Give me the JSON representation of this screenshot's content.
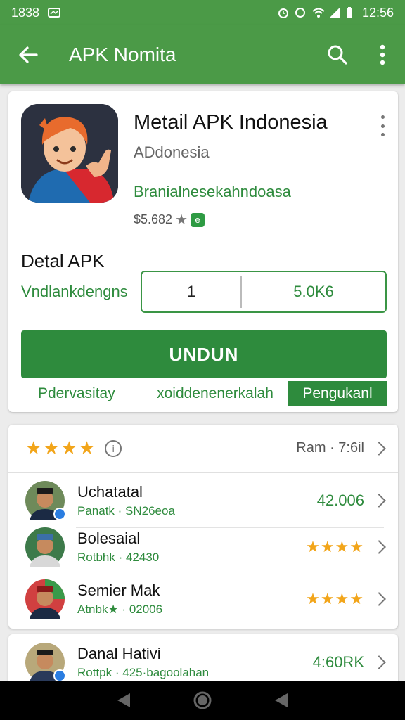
{
  "status": {
    "time_left": "1838",
    "time_right": "12:56"
  },
  "appbar": {
    "title": "APK Nomita",
    "back_icon": "arrow-left-icon",
    "search_icon": "search-icon",
    "more_icon": "more-vert-icon"
  },
  "app": {
    "name": "Metail APK Indonesia",
    "subtitle": "ADdonesia",
    "developer": "Branialnesekahndoasa",
    "price": "$5.682",
    "star": "★",
    "badge": "e"
  },
  "detail": {
    "title": "Detal APK",
    "label": "Vndlankdengns",
    "quantity": "1",
    "size": "5.0K6"
  },
  "download_button": "UNDUN",
  "tabs": [
    "Pdervasitay",
    "xoiddenenerkalah",
    "Pengukanl"
  ],
  "rating": {
    "stars": "★★★★",
    "info_icon": "i",
    "summary": "Ram · 7:6il"
  },
  "reviews": [
    {
      "name": "Uchatatal",
      "meta": "Panatk · SN26eoa",
      "right": "42.006",
      "stars": ""
    },
    {
      "name": "Bolesaial",
      "meta": "Rotbhk · 42430",
      "right": "",
      "stars": "★★★★"
    },
    {
      "name": "Semier Mak",
      "meta": "Atnbk★ · 02006",
      "right": "",
      "stars": "★★★★"
    },
    {
      "name": "Danal Hativi",
      "meta": "Rottpk · 425·bagoolahan",
      "right": "4:60RK",
      "stars": ""
    }
  ],
  "colors": {
    "primary": "#4b9a47",
    "accent": "#2e8b3d",
    "star": "#f2a51a"
  }
}
